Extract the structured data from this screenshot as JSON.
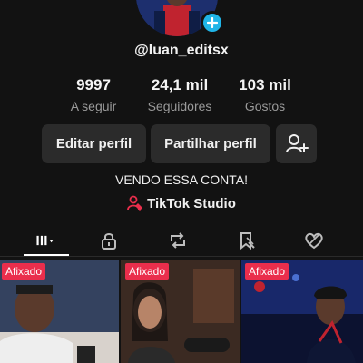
{
  "profile": {
    "username": "@luan_editsx",
    "stats": [
      {
        "value": "9997",
        "label": "A seguir"
      },
      {
        "value": "24,1 mil",
        "label": "Seguidores"
      },
      {
        "value": "103 mil",
        "label": "Gostos"
      }
    ],
    "bio": "VENDO ESSA CONTA!",
    "studio_link": "TikTok Studio"
  },
  "actions": {
    "edit_label": "Editar perfil",
    "share_label": "Partilhar perfil"
  },
  "tabs": [
    {
      "icon": "grid-icon"
    },
    {
      "icon": "lock-icon"
    },
    {
      "icon": "repost-icon"
    },
    {
      "icon": "bookmark-icon"
    },
    {
      "icon": "liked-heart-icon"
    }
  ],
  "videos": [
    {
      "badge": "Afixado"
    },
    {
      "badge": "Afixado"
    },
    {
      "badge": "Afixado"
    }
  ],
  "colors": {
    "background": "#121212",
    "button": "#2b2b2b",
    "accent_blue": "#20b5e8",
    "pinned_badge": "#ea2e4c",
    "studio_icon": "#ea2e4c"
  }
}
